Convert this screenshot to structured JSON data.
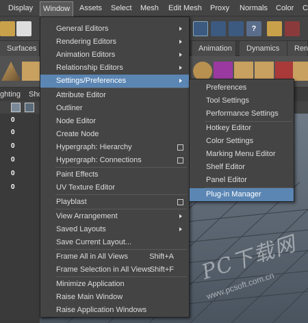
{
  "menubar": {
    "items": [
      "Display",
      "Window",
      "Assets",
      "Select",
      "Mesh",
      "Edit Mesh",
      "Proxy",
      "Normals",
      "Color",
      "C"
    ]
  },
  "shelf": {
    "tabs": [
      "Surfaces",
      "Animation",
      "Dynamics",
      "Ren"
    ]
  },
  "panel": {
    "lighting_label": "ghting",
    "show_label": "Sho"
  },
  "channel_values": [
    "0",
    "0",
    "0",
    "0",
    "0",
    "0"
  ],
  "window_menu": {
    "items": [
      {
        "label": "General Editors"
      },
      {
        "label": "Rendering Editors"
      },
      {
        "label": "Animation Editors"
      },
      {
        "label": "Relationship Editors"
      },
      {
        "label": "Settings/Preferences"
      },
      {
        "label": "Attribute Editor"
      },
      {
        "label": "Outliner"
      },
      {
        "label": "Node Editor"
      },
      {
        "label": "Create Node"
      },
      {
        "label": "Hypergraph: Hierarchy"
      },
      {
        "label": "Hypergraph: Connections"
      },
      {
        "label": "Paint Effects"
      },
      {
        "label": "UV Texture Editor"
      },
      {
        "label": "Playblast"
      },
      {
        "label": "View Arrangement"
      },
      {
        "label": "Saved Layouts"
      },
      {
        "label": "Save Current Layout..."
      },
      {
        "label": "Frame All in All Views",
        "shortcut": "Shift+A"
      },
      {
        "label": "Frame Selection in All Views",
        "shortcut": "Shift+F"
      },
      {
        "label": "Minimize Application"
      },
      {
        "label": "Raise Main Window"
      },
      {
        "label": "Raise Application Windows"
      }
    ]
  },
  "settings_submenu": {
    "items": [
      "Preferences",
      "Tool Settings",
      "Performance Settings",
      "Hotkey Editor",
      "Color Settings",
      "Marking Menu Editor",
      "Shelf Editor",
      "Panel Editor",
      "Plug-in Manager"
    ]
  },
  "watermark": {
    "text": "PC下载网",
    "url": "www.pcsoft.com.cn"
  },
  "colors": {
    "highlight": "#5b86b4",
    "menu_bg": "#444444"
  }
}
